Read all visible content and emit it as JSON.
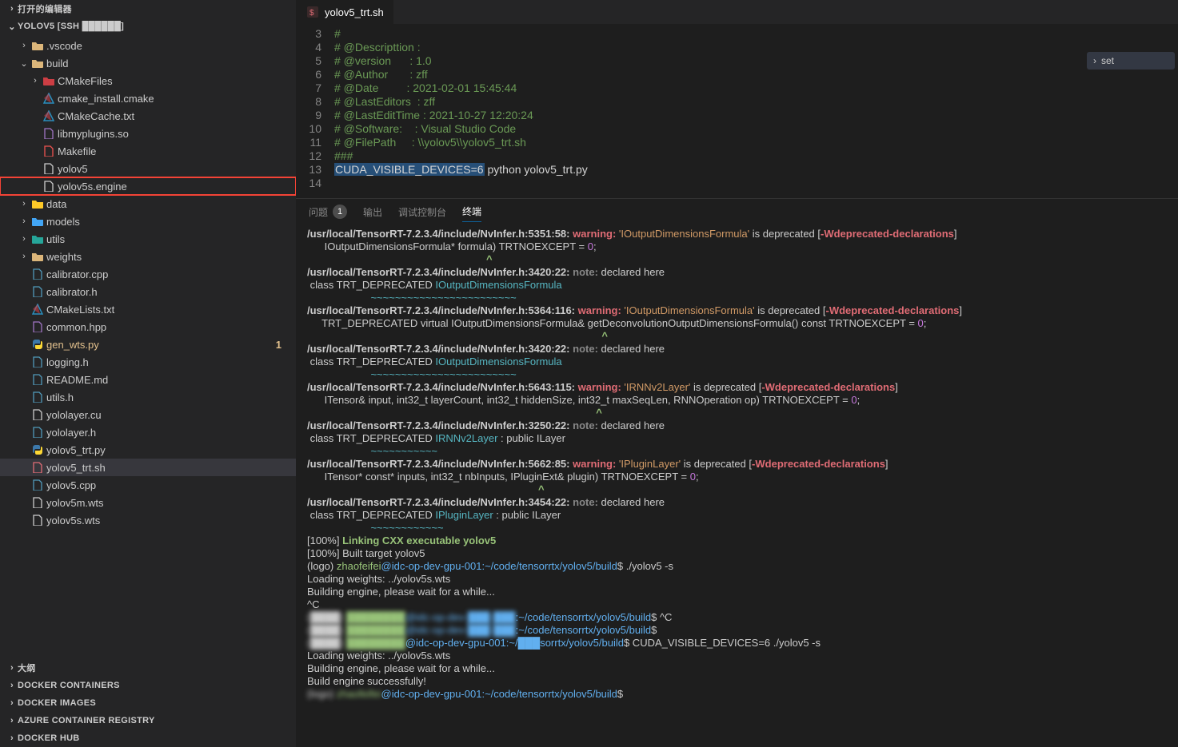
{
  "explorer": {
    "open_editors": "打开的编辑器",
    "root": "YOLOV5 [SSH ██████]",
    "tree": [
      {
        "d": 1,
        "ch": ">",
        "ic": "folder",
        "name": ".vscode"
      },
      {
        "d": 1,
        "ch": "v",
        "ic": "folder",
        "name": "build"
      },
      {
        "d": 2,
        "ch": ">",
        "ic": "folder-red",
        "name": "CMakeFiles"
      },
      {
        "d": 2,
        "ch": "",
        "ic": "cmake",
        "name": "cmake_install.cmake"
      },
      {
        "d": 2,
        "ch": "",
        "ic": "cmake",
        "name": "CMakeCache.txt"
      },
      {
        "d": 2,
        "ch": "",
        "ic": "lib",
        "name": "libmyplugins.so"
      },
      {
        "d": 2,
        "ch": "",
        "ic": "make",
        "name": "Makefile"
      },
      {
        "d": 2,
        "ch": "",
        "ic": "file",
        "name": "yolov5"
      },
      {
        "d": 2,
        "ch": "",
        "ic": "file",
        "name": "yolov5s.engine",
        "boxed": true
      },
      {
        "d": 1,
        "ch": ">",
        "ic": "db",
        "name": "data"
      },
      {
        "d": 1,
        "ch": ">",
        "ic": "models",
        "name": "models"
      },
      {
        "d": 1,
        "ch": ">",
        "ic": "utils",
        "name": "utils"
      },
      {
        "d": 1,
        "ch": ">",
        "ic": "folder",
        "name": "weights"
      },
      {
        "d": 1,
        "ch": "",
        "ic": "cpp",
        "name": "calibrator.cpp"
      },
      {
        "d": 1,
        "ch": "",
        "ic": "h",
        "name": "calibrator.h"
      },
      {
        "d": 1,
        "ch": "",
        "ic": "cmake",
        "name": "CMakeLists.txt"
      },
      {
        "d": 1,
        "ch": "",
        "ic": "hpp",
        "name": "common.hpp"
      },
      {
        "d": 1,
        "ch": "",
        "ic": "py",
        "name": "gen_wts.py",
        "mod": true,
        "badge": "1"
      },
      {
        "d": 1,
        "ch": "",
        "ic": "h",
        "name": "logging.h"
      },
      {
        "d": 1,
        "ch": "",
        "ic": "md",
        "name": "README.md"
      },
      {
        "d": 1,
        "ch": "",
        "ic": "h",
        "name": "utils.h"
      },
      {
        "d": 1,
        "ch": "",
        "ic": "file",
        "name": "yololayer.cu"
      },
      {
        "d": 1,
        "ch": "",
        "ic": "h",
        "name": "yololayer.h"
      },
      {
        "d": 1,
        "ch": "",
        "ic": "py",
        "name": "yolov5_trt.py"
      },
      {
        "d": 1,
        "ch": "",
        "ic": "sh",
        "name": "yolov5_trt.sh",
        "sel": true
      },
      {
        "d": 1,
        "ch": "",
        "ic": "cpp",
        "name": "yolov5.cpp"
      },
      {
        "d": 1,
        "ch": "",
        "ic": "file",
        "name": "yolov5m.wts"
      },
      {
        "d": 1,
        "ch": "",
        "ic": "file",
        "name": "yolov5s.wts"
      }
    ],
    "panels": [
      "大纲",
      "DOCKER CONTAINERS",
      "DOCKER IMAGES",
      "AZURE CONTAINER REGISTRY",
      "DOCKER HUB"
    ]
  },
  "tab": {
    "icon": "sh",
    "name": "yolov5_trt.sh"
  },
  "minimap": {
    "hint": "set"
  },
  "code": {
    "lines": [
      {
        "n": 3,
        "h": "#"
      },
      {
        "n": 4,
        "h": "# @Descripttion :"
      },
      {
        "n": 5,
        "h": "# @version      : 1.0"
      },
      {
        "n": 6,
        "h": "# @Author       : zff"
      },
      {
        "n": 7,
        "h": "# @Date         : 2021-02-01 15:45:44"
      },
      {
        "n": 8,
        "h": "# @LastEditors  : zff"
      },
      {
        "n": 9,
        "h": "# @LastEditTime : 2021-10-27 12:20:24"
      },
      {
        "n": 10,
        "h": "# @Software:    : Visual Studio Code"
      },
      {
        "n": 11,
        "h": "# @FilePath     : \\\\yolov5\\\\yolov5_trt.sh"
      },
      {
        "n": 12,
        "h": "###"
      },
      {
        "n": 13,
        "cmd": {
          "pre": "CUDA_VISIBLE_DEVICES=6",
          "rest": " python yolov5_trt.py"
        }
      },
      {
        "n": 14,
        "h": ""
      }
    ]
  },
  "panel": {
    "tabs": {
      "problems": "问题",
      "problems_count": "1",
      "output": "输出",
      "debug": "调试控制台",
      "terminal": "终端"
    }
  },
  "term": [
    {
      "t": "warn",
      "path": "/usr/local/TensorRT-7.2.3.4/include/NvInfer.h:5351:58:",
      "kw": "warning:",
      "q": "'IOutputDimensionsFormula'",
      "rest": " is deprecated [",
      "flag": "-Wdeprecated-declarations",
      "end": "]"
    },
    {
      "t": "body",
      "txt": "      IOutputDimensionsFormula* formula) TRTNOEXCEPT = ",
      "num": "0",
      "tail": ";"
    },
    {
      "t": "caret",
      "pos": 62
    },
    {
      "t": "note",
      "path": "/usr/local/TensorRT-7.2.3.4/include/NvInfer.h:3420:22:",
      "kw": "note:",
      "rest": " declared here"
    },
    {
      "t": "cls",
      "pre": " class TRT_DEPRECATED ",
      "cls": "IOutputDimensionsFormula"
    },
    {
      "t": "und",
      "pre": "                      ",
      "len": 24
    },
    {
      "t": "warn",
      "path": "/usr/local/TensorRT-7.2.3.4/include/NvInfer.h:5364:116:",
      "kw": "warning:",
      "q": "'IOutputDimensionsFormula'",
      "rest": " is deprecated [",
      "flag": "-Wdeprecated-declarations",
      "end": "]"
    },
    {
      "t": "body",
      "txt": "     TRT_DEPRECATED virtual IOutputDimensionsFormula& getDeconvolutionOutputDimensionsFormula() const TRTNOEXCEPT = ",
      "num": "0",
      "tail": ";"
    },
    {
      "t": "caret",
      "pos": 102
    },
    {
      "t": "note",
      "path": "/usr/local/TensorRT-7.2.3.4/include/NvInfer.h:3420:22:",
      "kw": "note:",
      "rest": " declared here"
    },
    {
      "t": "cls",
      "pre": " class TRT_DEPRECATED ",
      "cls": "IOutputDimensionsFormula"
    },
    {
      "t": "und",
      "pre": "                      ",
      "len": 24
    },
    {
      "t": "warn",
      "path": "/usr/local/TensorRT-7.2.3.4/include/NvInfer.h:5643:115:",
      "kw": "warning:",
      "q": "'IRNNv2Layer'",
      "rest": " is deprecated [",
      "flag": "-Wdeprecated-declarations",
      "end": "]"
    },
    {
      "t": "body",
      "txt": "      ITensor& input, int32_t layerCount, int32_t hiddenSize, int32_t maxSeqLen, RNNOperation op) TRTNOEXCEPT = ",
      "num": "0",
      "tail": ";"
    },
    {
      "t": "caret",
      "pos": 100
    },
    {
      "t": "note",
      "path": "/usr/local/TensorRT-7.2.3.4/include/NvInfer.h:3250:22:",
      "kw": "note:",
      "rest": " declared here"
    },
    {
      "t": "cls",
      "pre": " class TRT_DEPRECATED ",
      "cls": "IRNNv2Layer",
      "suf": " : public ILayer"
    },
    {
      "t": "und",
      "pre": "                      ",
      "len": 11
    },
    {
      "t": "warn",
      "path": "/usr/local/TensorRT-7.2.3.4/include/NvInfer.h:5662:85:",
      "kw": "warning:",
      "q": "'IPluginLayer'",
      "rest": " is deprecated [",
      "flag": "-Wdeprecated-declarations",
      "end": "]"
    },
    {
      "t": "body",
      "txt": "      ITensor* const* inputs, int32_t nbInputs, IPluginExt& plugin) TRTNOEXCEPT = ",
      "num": "0",
      "tail": ";"
    },
    {
      "t": "caret",
      "pos": 80
    },
    {
      "t": "note",
      "path": "/usr/local/TensorRT-7.2.3.4/include/NvInfer.h:3454:22:",
      "kw": "note:",
      "rest": " declared here"
    },
    {
      "t": "cls",
      "pre": " class TRT_DEPRECATED ",
      "cls": "IPluginLayer",
      "suf": " : public ILayer"
    },
    {
      "t": "und",
      "pre": "                      ",
      "len": 12
    },
    {
      "t": "pct",
      "pct": "[100%]",
      "grn": " Linking CXX executable yolov5"
    },
    {
      "t": "plain",
      "txt": "[100%] Built target yolov5"
    },
    {
      "t": "prompt",
      "logo": "(logo) ",
      "user": "zhaofeifei",
      "host": "@idc-op-dev-gpu-001",
      "dir": ":~/code/tensorrtx/yolov5/build",
      "cmd": "$ ./yolov5 -s"
    },
    {
      "t": "plain",
      "txt": "Loading weights: ../yolov5s.wts"
    },
    {
      "t": "plain",
      "txt": "Building engine, please wait for a while..."
    },
    {
      "t": "plain",
      "txt": "^C"
    },
    {
      "t": "prompt2",
      "pre": "(████) ",
      "blurpart": "████████",
      "host": "@idc-op-dev-███-███",
      "dir2": "de/tensorrtx/yolov5/build",
      "cmd": "$ ^C"
    },
    {
      "t": "prompt2",
      "pre": "(████) ",
      "blurpart": "████████",
      "host": "@idc-op-dev-███-███",
      "dir2": "de/tensorrtx/yolov5/build",
      "cmd": "$ "
    },
    {
      "t": "prompt",
      "logo": "(████) ",
      "user": "████████",
      "host": "@idc-op-dev-gpu-001",
      "dir": ":~/███sorrtx/yolov5/build",
      "cmd": "$ CUDA_VISIBLE_DEVICES=6 ./yolov5 -s",
      "blur": true
    },
    {
      "t": "plain",
      "txt": "Loading weights: ../yolov5s.wts"
    },
    {
      "t": "plain",
      "txt": "Building engine, please wait for a while..."
    },
    {
      "t": "plain",
      "txt": "Build engine successfully!"
    },
    {
      "t": "prompt",
      "logo": "(logo) ",
      "user": "zhaofeifei",
      "host": "@idc-op-dev-gpu-001",
      "dir": ":~/code/tensorrtx/yolov5/build",
      "cmd": "$ ",
      "blur": true
    }
  ]
}
